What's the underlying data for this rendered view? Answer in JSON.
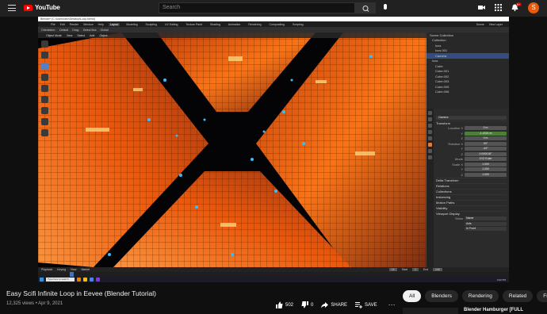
{
  "youtube": {
    "logo": "YouTube",
    "search_placeholder": "Search",
    "notification_count": "9+",
    "avatar_letter": "S"
  },
  "blender": {
    "title_bar": "Blender* [C:\\Users\\dev\\Desktop\\Loop.blend]",
    "menu": [
      "File",
      "Edit",
      "Render",
      "Window",
      "Help"
    ],
    "workspaces": [
      "Layout",
      "Modeling",
      "Sculpting",
      "UV Editing",
      "Texture Paint",
      "Shading",
      "Animation",
      "Rendering",
      "Compositing",
      "Scripting"
    ],
    "scene_label": "Scene",
    "view_layer_label": "View Layer",
    "viewport_header": [
      "Object Mode",
      "View",
      "Select",
      "Add",
      "Object"
    ],
    "tool_header": [
      "Orientation:",
      "Default",
      "Drag:",
      "Select Box",
      "Global"
    ],
    "outliner_items": [
      {
        "label": "Scene Collection",
        "selected": false
      },
      {
        "label": "Collection",
        "selected": false
      },
      {
        "label": "Icos",
        "selected": false
      },
      {
        "label": "Icos.001",
        "selected": false
      },
      {
        "label": "Camera",
        "selected": true
      },
      {
        "label": "Icos",
        "selected": false
      },
      {
        "label": "Cube",
        "selected": false
      },
      {
        "label": "Cube.001",
        "selected": false
      },
      {
        "label": "Cube.002",
        "selected": false
      },
      {
        "label": "Cube.003",
        "selected": false
      },
      {
        "label": "Cube.005",
        "selected": false
      },
      {
        "label": "Cube.006",
        "selected": false
      }
    ],
    "props_object": "Camera",
    "props_sections": {
      "transform": "Transform",
      "delta": "Delta Transform",
      "relations": "Relations",
      "collections": "Collections",
      "instancing": "Instancing",
      "motion": "Motion Paths",
      "visibility": "Visibility",
      "viewport_display": "Viewport Display"
    },
    "transform_rows": [
      {
        "label": "Location X",
        "value": "0 m",
        "green": false
      },
      {
        "label": "Y",
        "value": "-1.2321 m",
        "green": true
      },
      {
        "label": "Z",
        "value": "0 m",
        "green": false
      },
      {
        "label": "Rotation X",
        "value": "90°",
        "green": false
      },
      {
        "label": "Y",
        "value": "-44°",
        "green": false
      },
      {
        "label": "Z",
        "value": "0.000018°",
        "green": false
      },
      {
        "label": "Mode",
        "value": "XYZ Euler",
        "green": false
      },
      {
        "label": "Scale X",
        "value": "1.000",
        "green": false
      },
      {
        "label": "Y",
        "value": "1.000",
        "green": false
      },
      {
        "label": "Z",
        "value": "1.000",
        "green": false
      }
    ],
    "display_rows": [
      {
        "label": "Show",
        "value": "Name"
      },
      {
        "label": "",
        "value": "Axis"
      },
      {
        "label": "",
        "value": "In Front"
      }
    ],
    "timeline_menu": [
      "Playback",
      "Keying",
      "View",
      "Marker"
    ],
    "timeline_frames": {
      "current": "14",
      "start_label": "Start",
      "start": "1",
      "end_label": "End",
      "end": "240"
    },
    "taskbar_search": "Type here to search",
    "taskbar_time": "4:02 PM"
  },
  "video": {
    "title": "Easy Scifi Infinite Loop in Eevee (Blender Tutorial)",
    "views": "12,325 views",
    "date": "Apr 9, 2021",
    "likes": "502",
    "dislikes": "0",
    "share": "SHARE",
    "save": "SAVE"
  },
  "chips": [
    {
      "label": "All",
      "active": true
    },
    {
      "label": "Blenders",
      "active": false
    },
    {
      "label": "Rendering",
      "active": false
    },
    {
      "label": "Related",
      "active": false
    },
    {
      "label": "Fr",
      "active": false
    }
  ],
  "up_next_title": "Blender Hamburger [FULL"
}
